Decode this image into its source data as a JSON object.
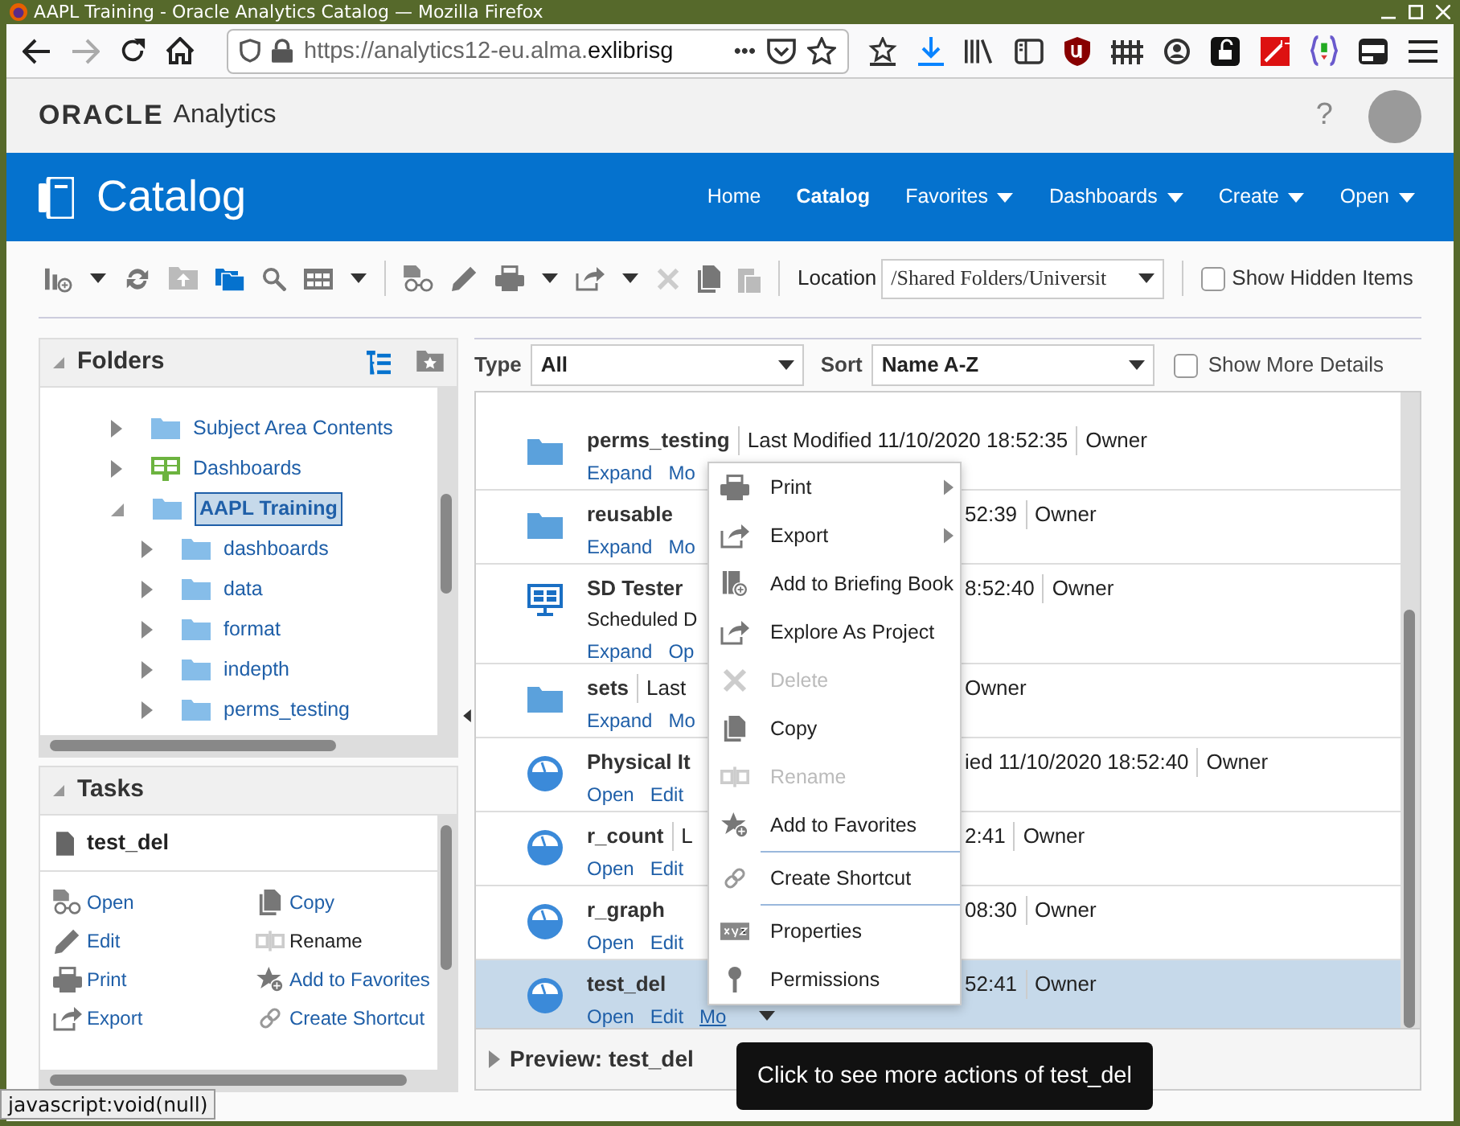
{
  "browser": {
    "window_title": "AAPL Training - Oracle Analytics Catalog — Mozilla Firefox",
    "url_dim": "https://analytics12-eu.alma.",
    "url_host": "exlibrisg",
    "page_actions": "•••"
  },
  "app_header": {
    "logo": "ORACLE",
    "product": "Analytics",
    "help": "?"
  },
  "banner": {
    "title": "Catalog",
    "nav": [
      {
        "label": "Home",
        "selected": false,
        "dropdown": false
      },
      {
        "label": "Catalog",
        "selected": true,
        "dropdown": false
      },
      {
        "label": "Favorites",
        "selected": false,
        "dropdown": true
      },
      {
        "label": "Dashboards",
        "selected": false,
        "dropdown": true
      },
      {
        "label": "Create",
        "selected": false,
        "dropdown": true
      },
      {
        "label": "Open",
        "selected": false,
        "dropdown": true
      }
    ]
  },
  "toolbar": {
    "location_label": "Location",
    "location_value": "/Shared Folders/Universit",
    "show_hidden": {
      "label": "Show Hidden Items",
      "checked": false
    }
  },
  "folders": {
    "title": "Folders",
    "tree": [
      {
        "label": "Subject Area Contents",
        "kind": "folder",
        "expanded": false,
        "selected": false
      },
      {
        "label": "Dashboards",
        "kind": "dashboard",
        "expanded": false,
        "selected": false
      },
      {
        "label": "AAPL Training",
        "kind": "folder",
        "expanded": true,
        "selected": true,
        "children": [
          {
            "label": "dashboards",
            "kind": "folder",
            "expanded": false,
            "selected": false
          },
          {
            "label": "data",
            "kind": "folder",
            "expanded": false,
            "selected": false
          },
          {
            "label": "format",
            "kind": "folder",
            "expanded": false,
            "selected": false
          },
          {
            "label": "indepth",
            "kind": "folder",
            "expanded": false,
            "selected": false
          },
          {
            "label": "perms_testing",
            "kind": "folder",
            "expanded": false,
            "selected": false
          }
        ]
      }
    ]
  },
  "tasks": {
    "title": "Tasks",
    "item": "test_del",
    "actions": [
      {
        "label": "Open",
        "enabled": true
      },
      {
        "label": "Copy",
        "enabled": true
      },
      {
        "label": "Edit",
        "enabled": true
      },
      {
        "label": "Rename",
        "enabled": false
      },
      {
        "label": "Print",
        "enabled": true
      },
      {
        "label": "Add to Favorites",
        "enabled": true
      },
      {
        "label": "Export",
        "enabled": true
      },
      {
        "label": "Create Shortcut",
        "enabled": true
      }
    ]
  },
  "filter": {
    "type_label": "Type",
    "type_value": "All",
    "sort_label": "Sort",
    "sort_value": "Name A-Z",
    "show_details": {
      "label": "Show More Details",
      "checked": false
    }
  },
  "items": [
    {
      "name": "perms_testing",
      "kind": "folder",
      "selected": false,
      "meta": [
        "Last Modified 11/10/2020 18:52:35",
        "Owner"
      ],
      "actions": [
        "Expand",
        "Mo"
      ]
    },
    {
      "name": "reusable",
      "kind": "folder",
      "selected": false,
      "meta_right": [
        "52:39",
        "Owner"
      ],
      "actions": [
        "Expand",
        "Mo"
      ]
    },
    {
      "name": "SD Tester",
      "kind": "dashboard",
      "selected": false,
      "meta_right": [
        "8:52:40",
        "Owner"
      ],
      "detail": "Scheduled D",
      "actions": [
        "Expand",
        "Op"
      ]
    },
    {
      "name": "sets",
      "kind": "folder",
      "selected": false,
      "meta": [
        "Last"
      ],
      "meta_right": [
        "Owner"
      ],
      "actions": [
        "Expand",
        "Mo"
      ]
    },
    {
      "name": "Physical It",
      "kind": "analysis",
      "selected": false,
      "meta_right": [
        "ied 11/10/2020 18:52:40",
        "Owner"
      ],
      "actions": [
        "Open",
        "Edit"
      ]
    },
    {
      "name": "r_count",
      "kind": "analysis",
      "selected": false,
      "meta": [
        "L"
      ],
      "meta_right": [
        "2:41",
        "Owner"
      ],
      "actions": [
        "Open",
        "Edit"
      ]
    },
    {
      "name": "r_graph",
      "kind": "analysis",
      "selected": false,
      "meta_right": [
        "08:30",
        "Owner"
      ],
      "actions": [
        "Open",
        "Edit"
      ]
    },
    {
      "name": "test_del",
      "kind": "analysis",
      "selected": true,
      "meta_right": [
        "52:41",
        "Owner"
      ],
      "actions": [
        "Open",
        "Edit",
        "Mo"
      ]
    }
  ],
  "context_menu": [
    {
      "label": "Print",
      "disabled": false,
      "submenu": true,
      "divider_before": false
    },
    {
      "label": "Export",
      "disabled": false,
      "submenu": true,
      "divider_before": false
    },
    {
      "label": "Add to Briefing Book",
      "disabled": false,
      "submenu": false,
      "divider_before": false
    },
    {
      "label": "Explore As Project",
      "disabled": false,
      "submenu": false,
      "divider_before": false
    },
    {
      "label": "Delete",
      "disabled": true,
      "submenu": false,
      "divider_before": false
    },
    {
      "label": "Copy",
      "disabled": false,
      "submenu": false,
      "divider_before": false
    },
    {
      "label": "Rename",
      "disabled": true,
      "submenu": false,
      "divider_before": false
    },
    {
      "label": "Add to Favorites",
      "disabled": false,
      "submenu": false,
      "divider_before": false
    },
    {
      "label": "Create Shortcut",
      "disabled": false,
      "submenu": false,
      "divider_before": true
    },
    {
      "label": "Properties",
      "disabled": false,
      "submenu": false,
      "divider_before": true
    },
    {
      "label": "Permissions",
      "disabled": false,
      "submenu": false,
      "divider_before": false
    }
  ],
  "preview": {
    "label": "Preview: test_del",
    "expanded": false
  },
  "tooltip": "Click to see more actions of test_del",
  "status_bar": "javascript:void(null)"
}
